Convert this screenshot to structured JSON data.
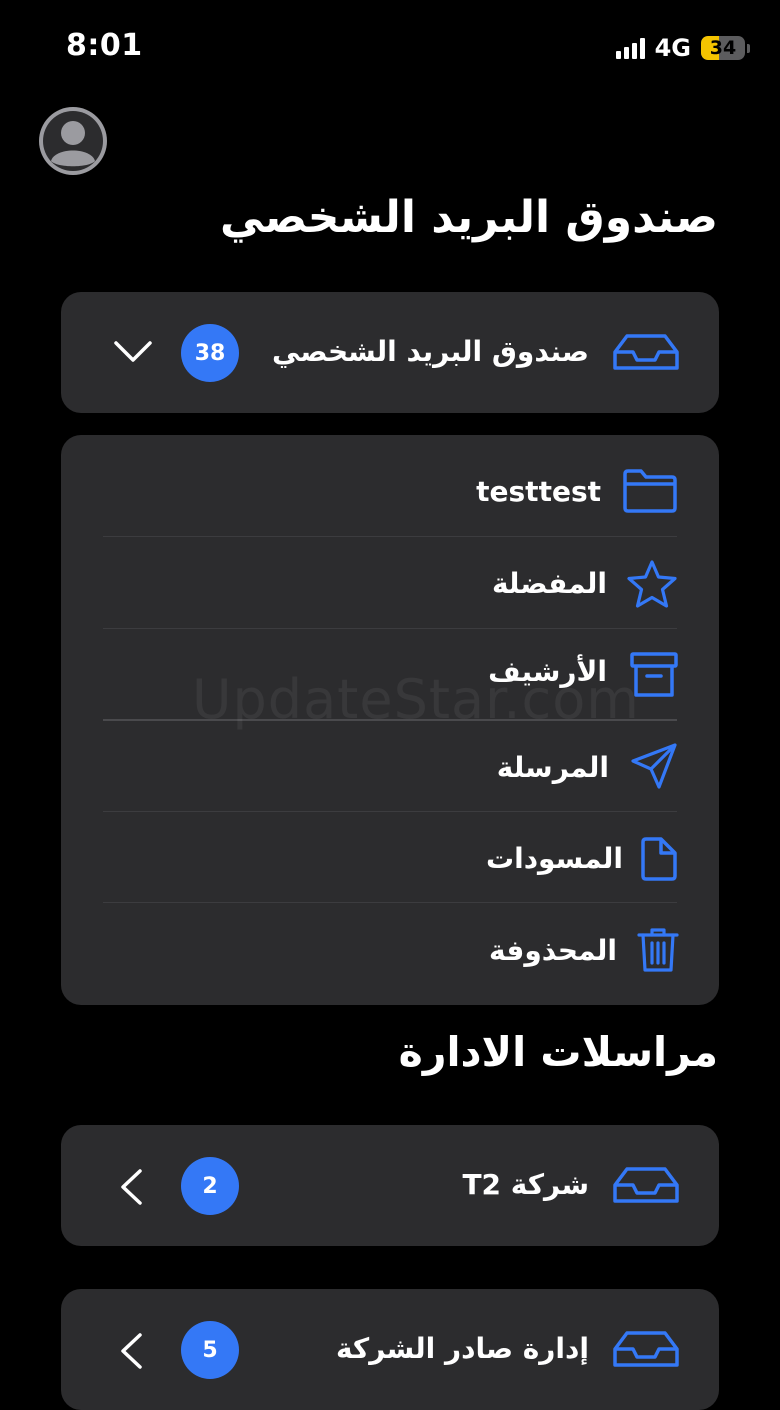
{
  "status_bar": {
    "time": "8:01",
    "network": "4G",
    "battery": "34",
    "battery_level": 0.34
  },
  "personal_section": {
    "title": "صندوق البريد الشخصي"
  },
  "inbox_card": {
    "label": "صندوق البريد الشخصي",
    "count": "38",
    "icon": "inbox-tray-icon",
    "chevron": "chevron-down-icon"
  },
  "folders": [
    {
      "label": "testtest",
      "icon": "folder-icon"
    },
    {
      "label": "المفضلة",
      "icon": "star-icon"
    },
    {
      "label": "الأرشيف",
      "icon": "archive-box-icon"
    },
    {
      "label": "المرسلة",
      "icon": "paper-plane-icon"
    },
    {
      "label": "المسودات",
      "icon": "document-icon"
    },
    {
      "label": "المحذوفة",
      "icon": "trash-icon"
    }
  ],
  "admin_section": {
    "title": "مراسلات الادارة"
  },
  "admin_mailboxes": [
    {
      "label": "شركة T2",
      "count": "2",
      "icon": "inbox-tray-icon",
      "chevron": "chevron-left-icon"
    },
    {
      "label": "إدارة صادر الشركة",
      "count": "5",
      "icon": "inbox-tray-icon",
      "chevron": "chevron-left-icon"
    }
  ],
  "watermark": "UpdateStar.com",
  "colors": {
    "accent": "#3478f6",
    "background": "#000000",
    "card": "#2c2c2e",
    "battery": "#f5c400"
  }
}
